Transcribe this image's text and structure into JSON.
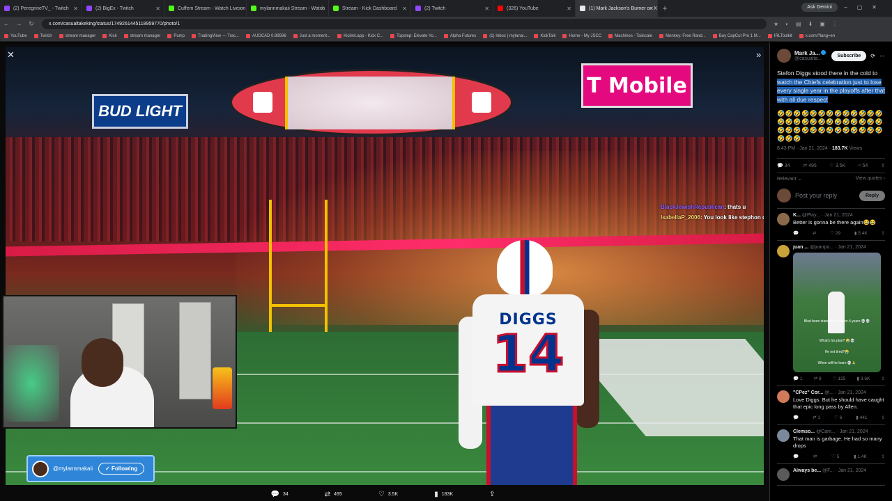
{
  "browser": {
    "tabs": [
      {
        "title": "(2) PeregrineTV_ - Twitch",
        "color": "#9146ff"
      },
      {
        "title": "(2) BigEx - Twitch",
        "color": "#9146ff"
      },
      {
        "title": "Cuffem Stream - Watch Live on",
        "color": "#53fc18"
      },
      {
        "title": "mylannmakaii Stream - Watch",
        "color": "#53fc18"
      },
      {
        "title": "Stream - Kick Dashboard",
        "color": "#53fc18"
      },
      {
        "title": "(2) Twitch",
        "color": "#9146ff"
      },
      {
        "title": "(326) YouTube",
        "color": "#ff0000"
      },
      {
        "title": "(1) Mark Jackson's Burner on X",
        "color": "#e7e9ea"
      }
    ],
    "ask_gemini": "Ask Gemini",
    "url": "x.com/casualtakeking/status/1749261445118959770/photo/1",
    "bookmarks": [
      "YouTube",
      "Twitch",
      "stream manager",
      "Kick",
      "stream manager",
      "Pump",
      "TradingView — Trac...",
      "AUDCAD 0.89596",
      "Just a moment...",
      "Kicklet.app - Kick C...",
      "Topstep: Elevate Yo...",
      "Alpha Futures",
      "(1) Inbox | mylanai...",
      "KickTalk",
      "Home - My JSCC",
      "Machines - Tailscale",
      "Monkey: Free Rand...",
      "Buy CapCut Pro 1 M...",
      "IRLToolkit",
      "x.com/?lang=en"
    ]
  },
  "photo": {
    "signs": {
      "bud_light": "BUD LIGHT",
      "tmobile": "T Mobile"
    },
    "jersey_name": "DIGGS",
    "jersey_number": "14",
    "overlay_chat": [
      {
        "user": "BlackJewishRepublican",
        "msg": ": thats u"
      },
      {
        "user": "IsabellaP_2006",
        "msg": ": You look like stephon dig"
      }
    ],
    "follow_card": {
      "handle": "@mylannmakaii",
      "button": "Following"
    },
    "stats": {
      "replies": "34",
      "reposts": "495",
      "likes": "3.5K",
      "views": "183K"
    }
  },
  "sidebar": {
    "author": {
      "name": "Mark Ja...",
      "handle": "@casualta..."
    },
    "subscribe_label": "Subscribe",
    "tweet_plain": "Stefon Diggs stood there in the cold to",
    "tweet_highlight": "watch the Chiefs celebration just to lose every single year in the playoffs after that with all due respect",
    "tweet_emojis": "🤣🤣🤣🤣🤣🤣🤣🤣🤣🤣🤣🤣🤣🤣🤣🤣🤣🤣🤣🤣🤣🤣🤣🤣🤣🤣🤣🤣🤣🤣🤣🤣🤣🤣🤣🤣🤣🤣🤣🤣🤣🤣",
    "time": "8:43 PM · Jan 21, 2024 · ",
    "views_count": "183.7K",
    "views_label": " Views",
    "actions": {
      "replies": "34",
      "reposts": "495",
      "likes": "3.5K",
      "bookmarks": "54"
    },
    "sort": "Relevant",
    "view_quotes": "View quotes",
    "reply_placeholder": "Post your reply",
    "reply_button": "Reply",
    "replies": [
      {
        "name": "K...",
        "handle": "@Play...",
        "date": "· Jan 21, 2024",
        "text": "Better is gonna be there again😂😂",
        "r": "",
        "rt": "",
        "l": "29",
        "v": "5.4K"
      },
      {
        "name": "juan ...",
        "handle": "@juanpa...",
        "date": "· Jan 21, 2024",
        "text": "",
        "r": "1",
        "rt": "8",
        "l": "125",
        "v": "3.6K",
        "media_caps": [
          "Blud been standing there for 4 years 💀💀",
          "What's his plan? 😭💀",
          "He not tired?😭",
          "When will he learn 💀🙏"
        ]
      },
      {
        "name": "\"CPez\" Cor...",
        "handle": "@...",
        "date": "· Jan 21, 2024",
        "text": "Love Diggs.  But he should have caught that epic long pass by Allen.",
        "r": "",
        "rt": "1",
        "l": "6",
        "v": "441"
      },
      {
        "name": "Clemso...",
        "handle": "@Cam...",
        "date": "· Jan 21, 2024",
        "text": "That man is garbage. He had so many drops",
        "r": "",
        "rt": "",
        "l": "5",
        "v": "1.4K"
      },
      {
        "name": "Always be...",
        "handle": "@F...",
        "date": "· Jan 21, 2024",
        "text": "",
        "r": "",
        "rt": "",
        "l": "",
        "v": ""
      }
    ]
  }
}
